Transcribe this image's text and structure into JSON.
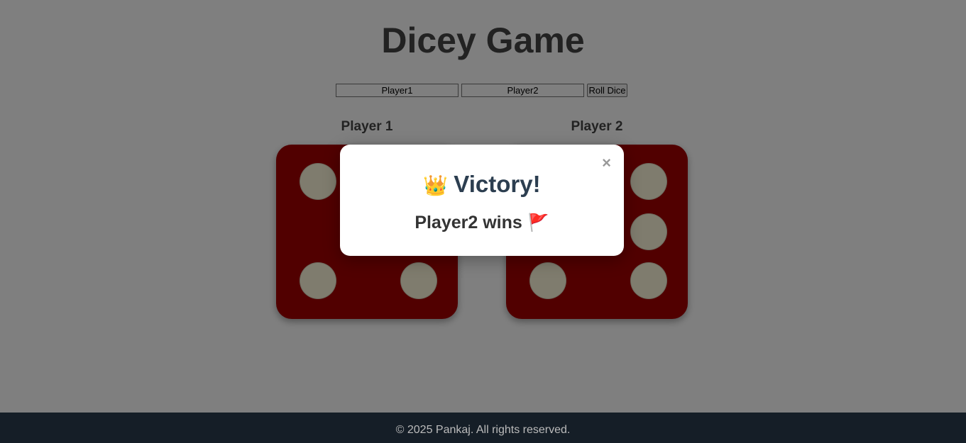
{
  "header": {
    "title": "Dicey Game"
  },
  "controls": {
    "player1_value": "Player1",
    "player2_value": "Player2",
    "roll_label": "Roll Dice"
  },
  "players": [
    {
      "label": "Player 1",
      "die_value": 4
    },
    {
      "label": "Player 2",
      "die_value": 6
    }
  ],
  "modal": {
    "close_symbol": "×",
    "heading_emoji": "👑",
    "heading": "Victory!",
    "message": "Player2 wins",
    "message_emoji": "🚩"
  },
  "footer": {
    "text": "© 2025 Pankaj. All rights reserved."
  },
  "colors": {
    "die": "#a30000",
    "pip": "#fff8dc",
    "footer_bg": "#151e27",
    "heading": "#2c3e50"
  }
}
